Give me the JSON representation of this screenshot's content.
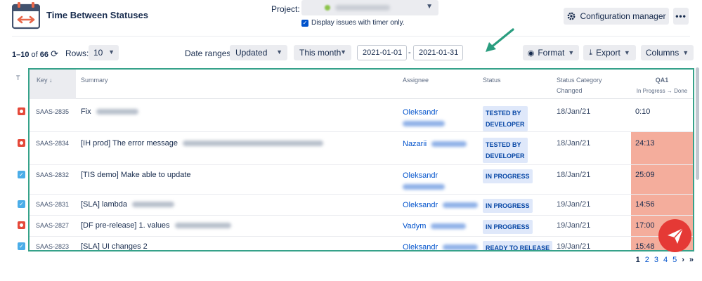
{
  "app": {
    "title": "Time Between Statuses",
    "icon": "calendar-arrows-icon"
  },
  "project": {
    "label": "Project:",
    "icon": "dropdown-caret-icon"
  },
  "timer": {
    "label": "Display issues with timer only.",
    "checked": true
  },
  "toolbar": {
    "config_label": "Configuration manager",
    "more_label": "•••",
    "range": "1–10",
    "of": "of",
    "total": "66",
    "rows_label": "Rows:",
    "rows_value": "10",
    "date_ranges_label": "Date ranges:",
    "range_field": "Updated",
    "range_period": "This month",
    "date_from": "2021-01-01",
    "date_sep": "-",
    "date_to": "2021-01-31",
    "format_label": "Format",
    "export_label": "Export",
    "columns_label": "Columns"
  },
  "table": {
    "headers": {
      "type": "T",
      "key": "Key ↓",
      "summary": "Summary",
      "assignee": "Assignee",
      "status": "Status",
      "changed_line1": "Status Category",
      "changed_line2": "Changed",
      "qa": "QA1",
      "qa_sub": "In Progress → Done"
    },
    "rows": [
      {
        "type": "bug",
        "key": "SAAS-2835",
        "summary": "Fix",
        "assignee_line1": "Oleksandr",
        "assignee_line2": "",
        "status_line1": "TESTED BY",
        "status_line2": "DEVELOPER",
        "changed": "18/Jan/21",
        "qa": "0:10",
        "hot": false
      },
      {
        "type": "bug",
        "key": "SAAS-2834",
        "summary": "[IH prod] The error message",
        "assignee_line1": "Nazarii",
        "assignee_line2": "",
        "status_line1": "TESTED BY",
        "status_line2": "DEVELOPER",
        "changed": "18/Jan/21",
        "qa": "24:13",
        "hot": true
      },
      {
        "type": "task",
        "key": "SAAS-2832",
        "summary": "[TIS demo] Make able to update",
        "assignee_line1": "Oleksandr",
        "assignee_line2": "",
        "status_line1": "IN PROGRESS",
        "status_line2": "",
        "changed": "18/Jan/21",
        "qa": "25:09",
        "hot": true
      },
      {
        "type": "task",
        "key": "SAAS-2831",
        "summary": "[SLA] lambda",
        "assignee_line1": "Oleksandr",
        "assignee_line2": "",
        "status_line1": "IN PROGRESS",
        "status_line2": "",
        "changed": "19/Jan/21",
        "qa": "14:56",
        "hot": true
      },
      {
        "type": "bug",
        "key": "SAAS-2827",
        "summary": "[DF pre-release] 1. values",
        "assignee_line1": "Vadym",
        "assignee_line2": "",
        "status_line1": "IN PROGRESS",
        "status_line2": "",
        "changed": "19/Jan/21",
        "qa": "17:00",
        "hot": true
      },
      {
        "type": "task",
        "key": "SAAS-2823",
        "summary": "[SLA] UI changes 2",
        "assignee_line1": "Oleksandr",
        "assignee_line2": "",
        "status_line1": "READY TO RELEASE",
        "status_line2": "",
        "changed": "19/Jan/21",
        "qa": "15:48",
        "hot": true
      }
    ]
  },
  "pager": {
    "pages": [
      "1",
      "2",
      "3",
      "4",
      "5"
    ],
    "current": "1",
    "next": "›",
    "last": "»"
  },
  "colors": {
    "accent": "#0052cc",
    "frame": "#36a28a",
    "hot": "#f4ad9c",
    "bug": "#e5493a",
    "task": "#4bade8",
    "fab": "#e53935"
  }
}
